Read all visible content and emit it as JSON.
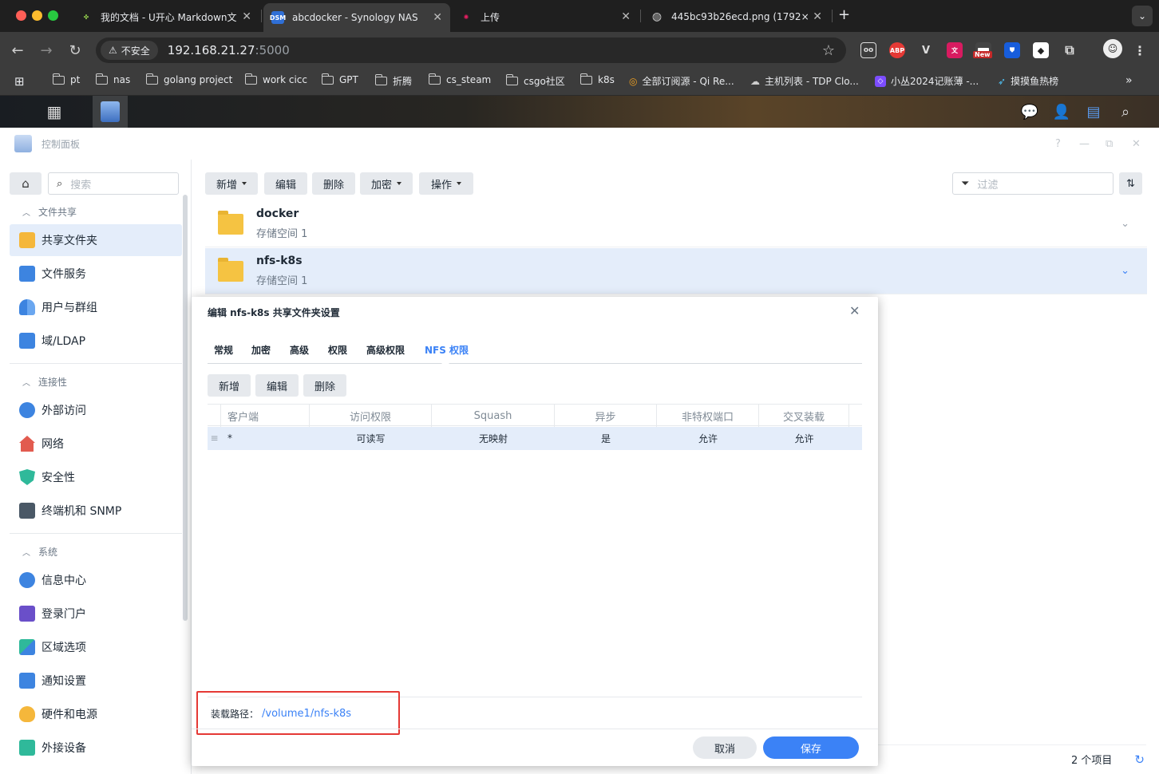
{
  "browser": {
    "tabs": [
      {
        "title": "我的文档 - U开心 Markdown文"
      },
      {
        "title": "abcdocker - Synology NAS"
      },
      {
        "title": "上传"
      },
      {
        "title": "445bc93b26ecd.png (1792×"
      }
    ],
    "new_tab": "+",
    "insecure_label": "不安全",
    "url_host": "192.168.21.27",
    "url_port": ":5000",
    "extensions": [
      {
        "name": "Abp",
        "text": "ABP",
        "color": "#e53935"
      },
      {
        "name": "New",
        "text": "New",
        "color": "#c62828"
      }
    ],
    "bookmarks": [
      "pt",
      "nas",
      "golang project",
      "work cicc",
      "GPT",
      "折腾",
      "cs_steam",
      "csgo社区",
      "k8s",
      "全部订阅源 - Qi Re...",
      "主机列表 - TDP Clo...",
      "小丛2024记账薄 -...",
      "摸摸鱼热榜"
    ],
    "bookmarks_more": "»"
  },
  "window": {
    "title": "控制面板",
    "help": "?"
  },
  "sidebar": {
    "search_placeholder": "搜索",
    "sections": [
      {
        "title": "文件共享",
        "items": [
          "共享文件夹",
          "文件服务",
          "用户与群组",
          "域/LDAP"
        ]
      },
      {
        "title": "连接性",
        "items": [
          "外部访问",
          "网络",
          "安全性",
          "终端机和 SNMP"
        ]
      },
      {
        "title": "系统",
        "items": [
          "信息中心",
          "登录门户",
          "区域选项",
          "通知设置",
          "硬件和电源",
          "外接设备"
        ]
      }
    ]
  },
  "toolbar": {
    "create": "新增",
    "edit": "编辑",
    "delete": "删除",
    "encrypt": "加密",
    "action": "操作",
    "filter_placeholder": "过滤"
  },
  "folders": [
    {
      "name": "docker",
      "sub": "存储空间 1"
    },
    {
      "name": "nfs-k8s",
      "sub": "存储空间 1"
    }
  ],
  "status": {
    "count": "2 个项目"
  },
  "dialog": {
    "title": "编辑 nfs-k8s 共享文件夹设置",
    "tabs": [
      "常规",
      "加密",
      "高级",
      "权限",
      "高级权限",
      "NFS 权限"
    ],
    "active_tab": 5,
    "buttons": {
      "create": "新增",
      "edit": "编辑",
      "delete": "删除"
    },
    "columns": [
      "客户端",
      "访问权限",
      "Squash",
      "异步",
      "非特权端口",
      "交叉装载"
    ],
    "rows": [
      [
        "*",
        "可读写",
        "无映射",
        "是",
        "允许",
        "允许"
      ]
    ],
    "mount_label": "装载路径：",
    "mount_path": "/volume1/nfs-k8s",
    "cancel": "取消",
    "save": "保存",
    "accent": "#3b82f6",
    "highlight_border": "#e53935"
  }
}
